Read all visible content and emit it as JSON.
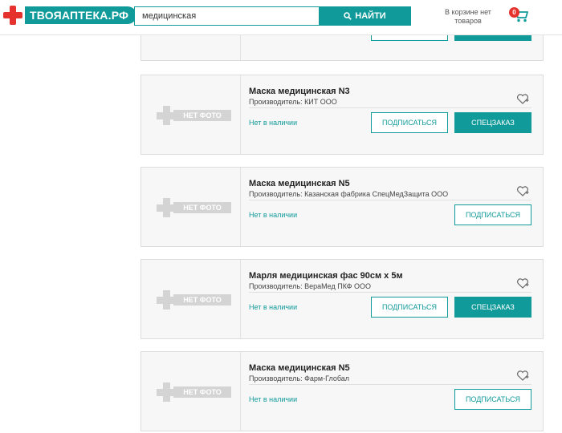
{
  "header": {
    "logo_text": "ТВОЯАПТЕКА.РФ",
    "search_value": "медицинская",
    "search_button": "НАЙТИ",
    "cart_text": "В корзине нет товаров",
    "cart_count": "0"
  },
  "colors": {
    "accent": "#119a9a",
    "brand_red": "#e5322d",
    "placeholder_gray": "#d4d4d4"
  },
  "products": [
    {
      "photo_label": "НЕТ ФОТО",
      "title": "Маска медицинская N3",
      "maker": "Производитель: КИТ ООО",
      "stock": "Нет в наличии",
      "subscribe_label": "ПОДПИСАТЬСЯ",
      "special_label": "СПЕЦЗАКАЗ"
    },
    {
      "photo_label": "НЕТ ФОТО",
      "title": "Маска медицинская N5",
      "maker": "Производитель: Казанская фабрика СпецМедЗащита ООО",
      "stock": "Нет в наличии",
      "subscribe_label": "ПОДПИСАТЬСЯ"
    },
    {
      "photo_label": "НЕТ ФОТО",
      "title": "Марля медицинская фас 90см х 5м",
      "maker": "Производитель: ВераМед ПКФ ООО",
      "stock": "Нет в наличии",
      "subscribe_label": "ПОДПИСАТЬСЯ",
      "special_label": "СПЕЦЗАКАЗ"
    },
    {
      "photo_label": "НЕТ ФОТО",
      "title": "Маска медицинская N5",
      "maker": "Производитель: Фарм-Глобал",
      "stock": "Нет в наличии",
      "subscribe_label": "ПОДПИСАТЬСЯ"
    }
  ]
}
